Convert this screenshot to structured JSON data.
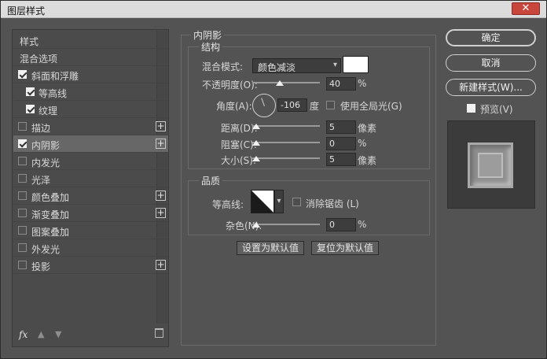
{
  "window": {
    "title": "图层样式",
    "close": "✕"
  },
  "left": {
    "items": [
      {
        "label": "样式",
        "checkbox": false,
        "checked": false,
        "plus": false,
        "selected": false
      },
      {
        "label": "混合选项",
        "checkbox": false,
        "checked": false,
        "plus": false,
        "selected": false
      },
      {
        "label": "斜面和浮雕",
        "checkbox": true,
        "checked": true,
        "plus": false,
        "selected": false
      },
      {
        "label": "等高线",
        "checkbox": true,
        "checked": true,
        "plus": false,
        "selected": false,
        "indent": true
      },
      {
        "label": "纹理",
        "checkbox": true,
        "checked": true,
        "plus": false,
        "selected": false,
        "indent": true
      },
      {
        "label": "描边",
        "checkbox": true,
        "checked": false,
        "plus": true,
        "selected": false
      },
      {
        "label": "内阴影",
        "checkbox": true,
        "checked": true,
        "plus": true,
        "selected": true
      },
      {
        "label": "内发光",
        "checkbox": true,
        "checked": false,
        "plus": false,
        "selected": false
      },
      {
        "label": "光泽",
        "checkbox": true,
        "checked": false,
        "plus": false,
        "selected": false
      },
      {
        "label": "颜色叠加",
        "checkbox": true,
        "checked": false,
        "plus": true,
        "selected": false
      },
      {
        "label": "渐变叠加",
        "checkbox": true,
        "checked": false,
        "plus": true,
        "selected": false
      },
      {
        "label": "图案叠加",
        "checkbox": true,
        "checked": false,
        "plus": false,
        "selected": false
      },
      {
        "label": "外发光",
        "checkbox": true,
        "checked": false,
        "plus": false,
        "selected": false
      },
      {
        "label": "投影",
        "checkbox": true,
        "checked": false,
        "plus": true,
        "selected": false
      }
    ],
    "footer": {
      "fx": "fx",
      "up": "▲",
      "down": "▼"
    }
  },
  "inner_shadow": {
    "title": "内阴影",
    "structure": {
      "title": "结构",
      "blend_mode_label": "混合模式:",
      "blend_mode_value": "颜色减淡",
      "color": "#ffffff",
      "opacity_label": "不透明度(O):",
      "opacity_value": "40",
      "opacity_unit": "%",
      "angle_label": "角度(A):",
      "angle_value": "-106",
      "angle_unit": "度",
      "global_light_label": "使用全局光(G)",
      "distance_label": "距离(D):",
      "distance_value": "5",
      "distance_unit": "像素",
      "choke_label": "阻塞(C):",
      "choke_value": "0",
      "choke_unit": "%",
      "size_label": "大小(S):",
      "size_value": "5",
      "size_unit": "像素"
    },
    "quality": {
      "title": "品质",
      "contour_label": "等高线:",
      "antialias_label": "消除锯齿 (L)",
      "noise_label": "杂色(N):",
      "noise_value": "0",
      "noise_unit": "%"
    },
    "buttons": {
      "make_default": "设置为默认值",
      "reset_default": "复位为默认值"
    }
  },
  "right": {
    "ok": "确定",
    "cancel": "取消",
    "new_style": "新建样式(W)...",
    "preview_label": "预览(V)"
  }
}
